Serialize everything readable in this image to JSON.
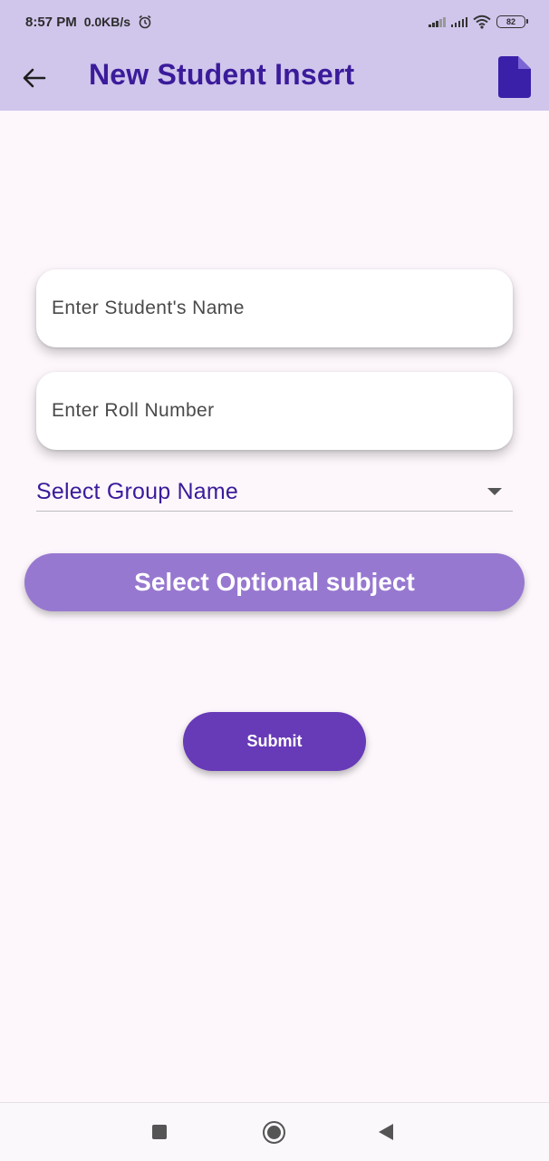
{
  "status_bar": {
    "time": "8:57 PM",
    "net_speed": "0.0KB/s",
    "battery": "82"
  },
  "app_bar": {
    "title": "New Student Insert",
    "back_icon": "arrow-left-icon",
    "action_icon": "document-icon"
  },
  "form": {
    "name_placeholder": "Enter Student's Name",
    "name_value": "",
    "roll_placeholder": "Enter Roll Number",
    "roll_value": "",
    "group_dropdown_label": "Select Group Name",
    "optional_subject_label": "Select Optional subject",
    "submit_label": "Submit"
  },
  "nav_bar": {
    "recents_icon": "square-icon",
    "home_icon": "circle-icon",
    "back_icon": "triangle-back-icon"
  },
  "colors": {
    "app_bar_bg": "#d0c5eb",
    "title_color": "#3a1b9a",
    "optional_button_bg": "#9778d0",
    "submit_button_bg": "#673ab7",
    "page_bg": "#fdf7fc"
  }
}
